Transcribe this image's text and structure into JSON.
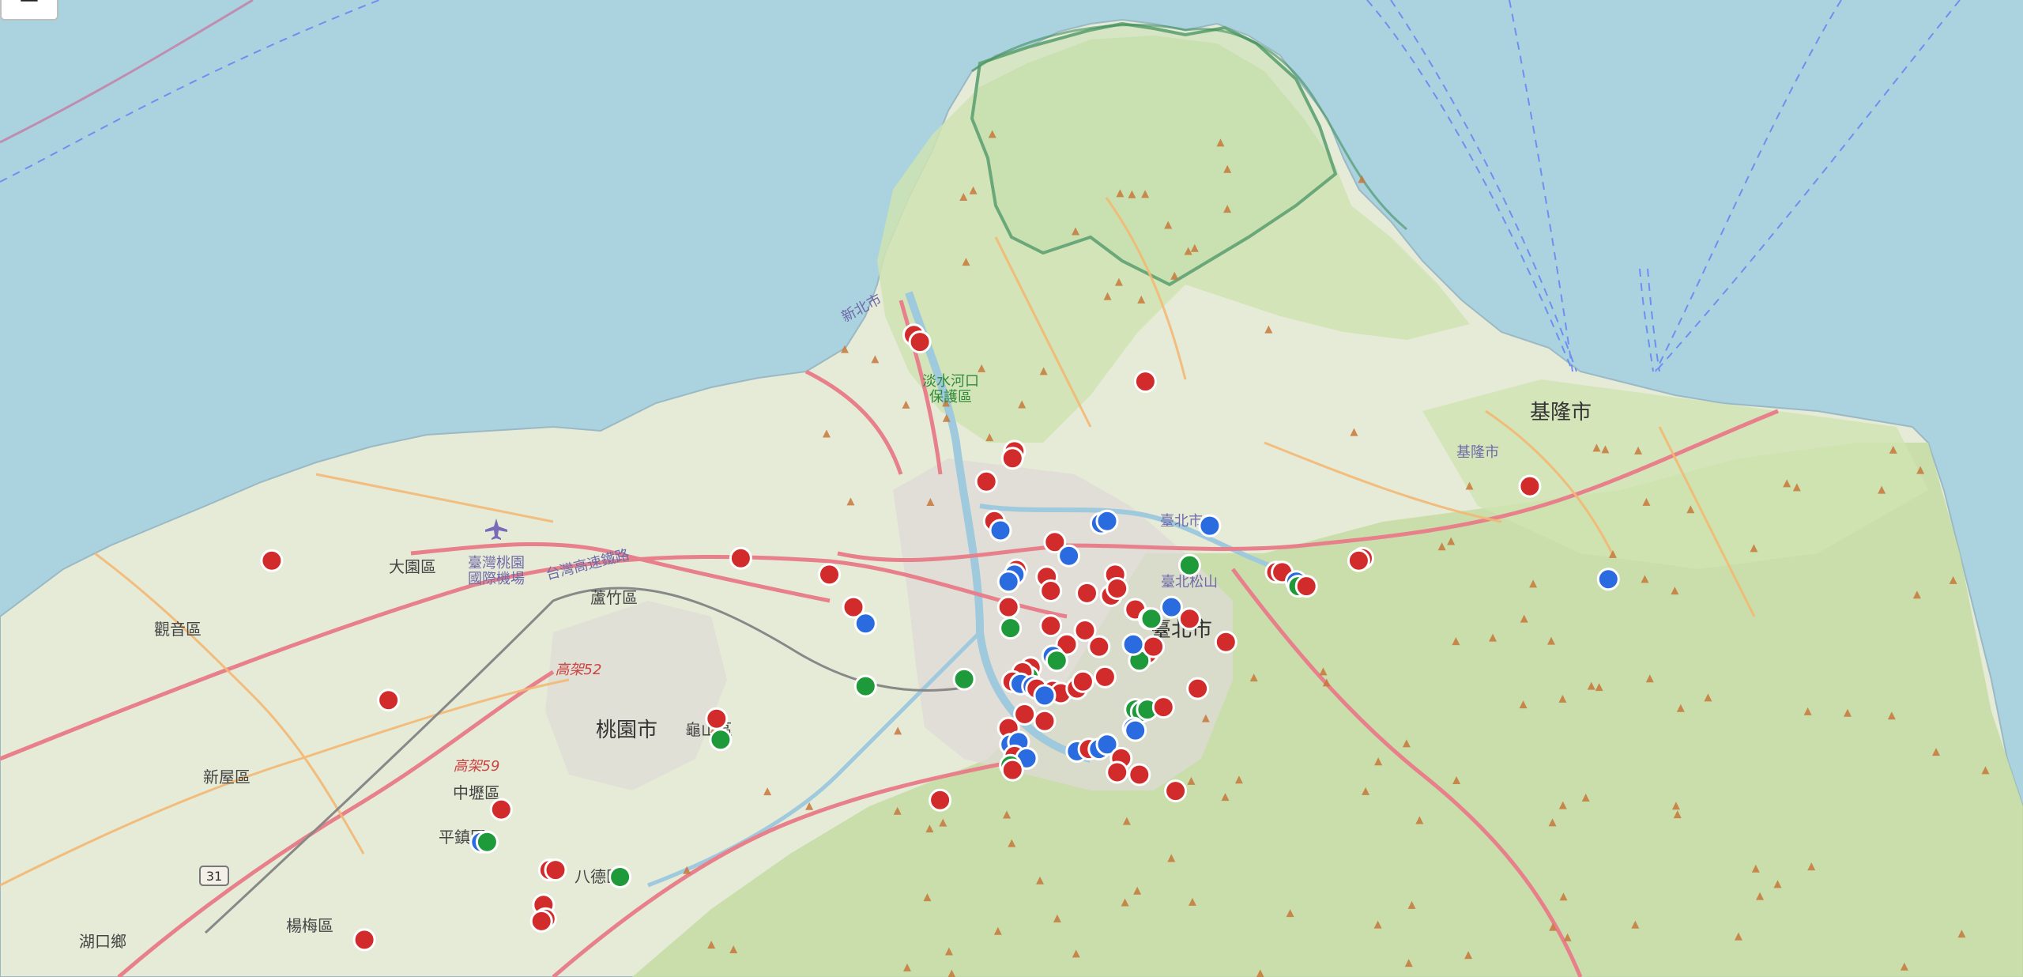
{
  "map": {
    "zoom_out_label": "−",
    "labels": {
      "keelung_city": "基隆市",
      "keelung_city_small": "基隆市",
      "taipei_city": "臺北市",
      "taipei_city_big": "臺北市",
      "taoyuan_city": "桃園市",
      "dayuan": "大園區",
      "luzhu": "蘆竹區",
      "guanyin": "觀音區",
      "xinwu": "新屋區",
      "zhongli": "中壢區",
      "pingzhen": "平鎮區",
      "yangmei": "楊梅區",
      "guishan": "龜山區",
      "bade": "八德區",
      "hukou": "湖口鄉",
      "new_taipei": "新北市",
      "airport": "臺灣桃園\n國際機場",
      "songshan": "臺北松山",
      "tamsui_reserve": "淡水河口\n保護區",
      "highway_taiwan": "台灣高速鐵路",
      "highway_52": "高架52",
      "highway_59": "高架59",
      "route_31": "31"
    }
  },
  "marker_colors": {
    "red": "#d22b2b",
    "blue": "#2b6be0",
    "green": "#1e9a3a"
  },
  "markers": [
    {
      "c": "red",
      "lat": 25.161,
      "lon": 121.434
    },
    {
      "c": "red",
      "lat": 25.158,
      "lon": 121.437
    },
    {
      "c": "red",
      "lat": 25.141,
      "lon": 121.549
    },
    {
      "c": "red",
      "lat": 25.111,
      "lon": 121.484
    },
    {
      "c": "red",
      "lat": 25.108,
      "lon": 121.483
    },
    {
      "c": "red",
      "lat": 25.098,
      "lon": 121.47
    },
    {
      "c": "red",
      "lat": 25.081,
      "lon": 121.474
    },
    {
      "c": "blue",
      "lat": 25.077,
      "lon": 121.477
    },
    {
      "c": "red",
      "lat": 25.072,
      "lon": 121.504
    },
    {
      "c": "blue",
      "lat": 25.066,
      "lon": 121.511
    },
    {
      "c": "blue",
      "lat": 25.08,
      "lon": 121.527
    },
    {
      "c": "blue",
      "lat": 25.081,
      "lon": 121.53
    },
    {
      "c": "blue",
      "lat": 25.079,
      "lon": 121.581
    },
    {
      "c": "red",
      "lat": 25.06,
      "lon": 121.485
    },
    {
      "c": "blue",
      "lat": 25.058,
      "lon": 121.484
    },
    {
      "c": "blue",
      "lat": 25.055,
      "lon": 121.481
    },
    {
      "c": "red",
      "lat": 25.057,
      "lon": 121.5
    },
    {
      "c": "red",
      "lat": 25.051,
      "lon": 121.502
    },
    {
      "c": "red",
      "lat": 25.05,
      "lon": 121.52
    },
    {
      "c": "red",
      "lat": 25.049,
      "lon": 121.532
    },
    {
      "c": "red",
      "lat": 25.058,
      "lon": 121.534
    },
    {
      "c": "red",
      "lat": 25.052,
      "lon": 121.535
    },
    {
      "c": "green",
      "lat": 25.062,
      "lon": 121.571
    },
    {
      "c": "red",
      "lat": 25.043,
      "lon": 121.544
    },
    {
      "c": "blue",
      "lat": 25.044,
      "lon": 121.562
    },
    {
      "c": "red",
      "lat": 25.039,
      "lon": 121.571
    },
    {
      "c": "green",
      "lat": 25.039,
      "lon": 121.551
    },
    {
      "c": "green",
      "lat": 25.039,
      "lon": 121.552
    },
    {
      "c": "red",
      "lat": 25.024,
      "lon": 121.55
    },
    {
      "c": "green",
      "lat": 25.021,
      "lon": 121.546
    },
    {
      "c": "red",
      "lat": 25.027,
      "lon": 121.553
    },
    {
      "c": "blue",
      "lat": 25.028,
      "lon": 121.543
    },
    {
      "c": "red",
      "lat": 25.027,
      "lon": 121.526
    },
    {
      "c": "red",
      "lat": 25.029,
      "lon": 121.589
    },
    {
      "c": "red",
      "lat": 25.059,
      "lon": 121.614
    },
    {
      "c": "red",
      "lat": 25.059,
      "lon": 121.617
    },
    {
      "c": "blue",
      "lat": 25.055,
      "lon": 121.624
    },
    {
      "c": "green",
      "lat": 25.053,
      "lon": 121.625
    },
    {
      "c": "red",
      "lat": 25.053,
      "lon": 121.629
    },
    {
      "c": "red",
      "lat": 25.065,
      "lon": 121.657
    },
    {
      "c": "red",
      "lat": 25.064,
      "lon": 121.655
    },
    {
      "c": "red",
      "lat": 25.096,
      "lon": 121.74
    },
    {
      "c": "blue",
      "lat": 25.056,
      "lon": 121.779
    },
    {
      "c": "red",
      "lat": 25.044,
      "lon": 121.481
    },
    {
      "c": "green",
      "lat": 25.035,
      "lon": 121.482
    },
    {
      "c": "red",
      "lat": 25.036,
      "lon": 121.502
    },
    {
      "c": "red",
      "lat": 25.034,
      "lon": 121.519
    },
    {
      "c": "red",
      "lat": 25.028,
      "lon": 121.51
    },
    {
      "c": "blue",
      "lat": 25.023,
      "lon": 121.503
    },
    {
      "c": "green",
      "lat": 25.021,
      "lon": 121.505
    },
    {
      "c": "red",
      "lat": 25.018,
      "lon": 121.492
    },
    {
      "c": "green",
      "lat": 25.014,
      "lon": 121.491
    },
    {
      "c": "red",
      "lat": 25.016,
      "lon": 121.488
    },
    {
      "c": "red",
      "lat": 25.012,
      "lon": 121.483
    },
    {
      "c": "blue",
      "lat": 25.011,
      "lon": 121.487
    },
    {
      "c": "blue",
      "lat": 25.01,
      "lon": 121.493
    },
    {
      "c": "red",
      "lat": 25.009,
      "lon": 121.495
    },
    {
      "c": "red",
      "lat": 25.008,
      "lon": 121.503
    },
    {
      "c": "red",
      "lat": 25.007,
      "lon": 121.507
    },
    {
      "c": "blue",
      "lat": 25.006,
      "lon": 121.499
    },
    {
      "c": "red",
      "lat": 25.009,
      "lon": 121.515
    },
    {
      "c": "red",
      "lat": 25.012,
      "lon": 121.518
    },
    {
      "c": "red",
      "lat": 25.014,
      "lon": 121.529
    },
    {
      "c": "red",
      "lat": 24.998,
      "lon": 121.489
    },
    {
      "c": "red",
      "lat": 24.995,
      "lon": 121.499
    },
    {
      "c": "red",
      "lat": 24.992,
      "lon": 121.481
    },
    {
      "c": "blue",
      "lat": 24.985,
      "lon": 121.482
    },
    {
      "c": "blue",
      "lat": 24.986,
      "lon": 121.486
    },
    {
      "c": "red",
      "lat": 24.98,
      "lon": 121.484
    },
    {
      "c": "blue",
      "lat": 24.979,
      "lon": 121.49
    },
    {
      "c": "green",
      "lat": 24.976,
      "lon": 121.482
    },
    {
      "c": "red",
      "lat": 24.974,
      "lon": 121.483
    },
    {
      "c": "blue",
      "lat": 24.982,
      "lon": 121.515
    },
    {
      "c": "red",
      "lat": 24.983,
      "lon": 121.521
    },
    {
      "c": "blue",
      "lat": 24.983,
      "lon": 121.526
    },
    {
      "c": "blue",
      "lat": 24.985,
      "lon": 121.53
    },
    {
      "c": "red",
      "lat": 24.979,
      "lon": 121.537
    },
    {
      "c": "red",
      "lat": 24.973,
      "lon": 121.535
    },
    {
      "c": "red",
      "lat": 24.972,
      "lon": 121.546
    },
    {
      "c": "green",
      "lat": 25.0,
      "lon": 121.544
    },
    {
      "c": "green",
      "lat": 24.999,
      "lon": 121.547
    },
    {
      "c": "blue",
      "lat": 24.992,
      "lon": 121.543
    },
    {
      "c": "blue",
      "lat": 24.991,
      "lon": 121.544
    },
    {
      "c": "green",
      "lat": 25.0,
      "lon": 121.55
    },
    {
      "c": "red",
      "lat": 25.001,
      "lon": 121.558
    },
    {
      "c": "red",
      "lat": 25.009,
      "lon": 121.575
    },
    {
      "c": "red",
      "lat": 24.965,
      "lon": 121.564
    },
    {
      "c": "red",
      "lat": 24.961,
      "lon": 121.447
    },
    {
      "c": "green",
      "lat": 25.013,
      "lon": 121.459
    },
    {
      "c": "green",
      "lat": 25.01,
      "lon": 121.41
    },
    {
      "c": "red",
      "lat": 25.058,
      "lon": 121.392
    },
    {
      "c": "red",
      "lat": 25.044,
      "lon": 121.404
    },
    {
      "c": "blue",
      "lat": 25.037,
      "lon": 121.41
    },
    {
      "c": "red",
      "lat": 25.065,
      "lon": 121.348
    },
    {
      "c": "red",
      "lat": 24.996,
      "lon": 121.336
    },
    {
      "c": "green",
      "lat": 24.987,
      "lon": 121.338
    },
    {
      "c": "red",
      "lat": 25.064,
      "lon": 121.115
    },
    {
      "c": "red",
      "lat": 25.004,
      "lon": 121.173
    },
    {
      "c": "red",
      "lat": 24.957,
      "lon": 121.229
    },
    {
      "c": "blue",
      "lat": 24.943,
      "lon": 121.219
    },
    {
      "c": "green",
      "lat": 24.943,
      "lon": 121.222
    },
    {
      "c": "red",
      "lat": 24.931,
      "lon": 121.253
    },
    {
      "c": "red",
      "lat": 24.931,
      "lon": 121.256
    },
    {
      "c": "red",
      "lat": 24.916,
      "lon": 121.25
    },
    {
      "c": "red",
      "lat": 24.91,
      "lon": 121.251
    },
    {
      "c": "red",
      "lat": 24.909,
      "lon": 121.249
    },
    {
      "c": "green",
      "lat": 24.928,
      "lon": 121.288
    },
    {
      "c": "red",
      "lat": 24.901,
      "lon": 121.161
    }
  ]
}
